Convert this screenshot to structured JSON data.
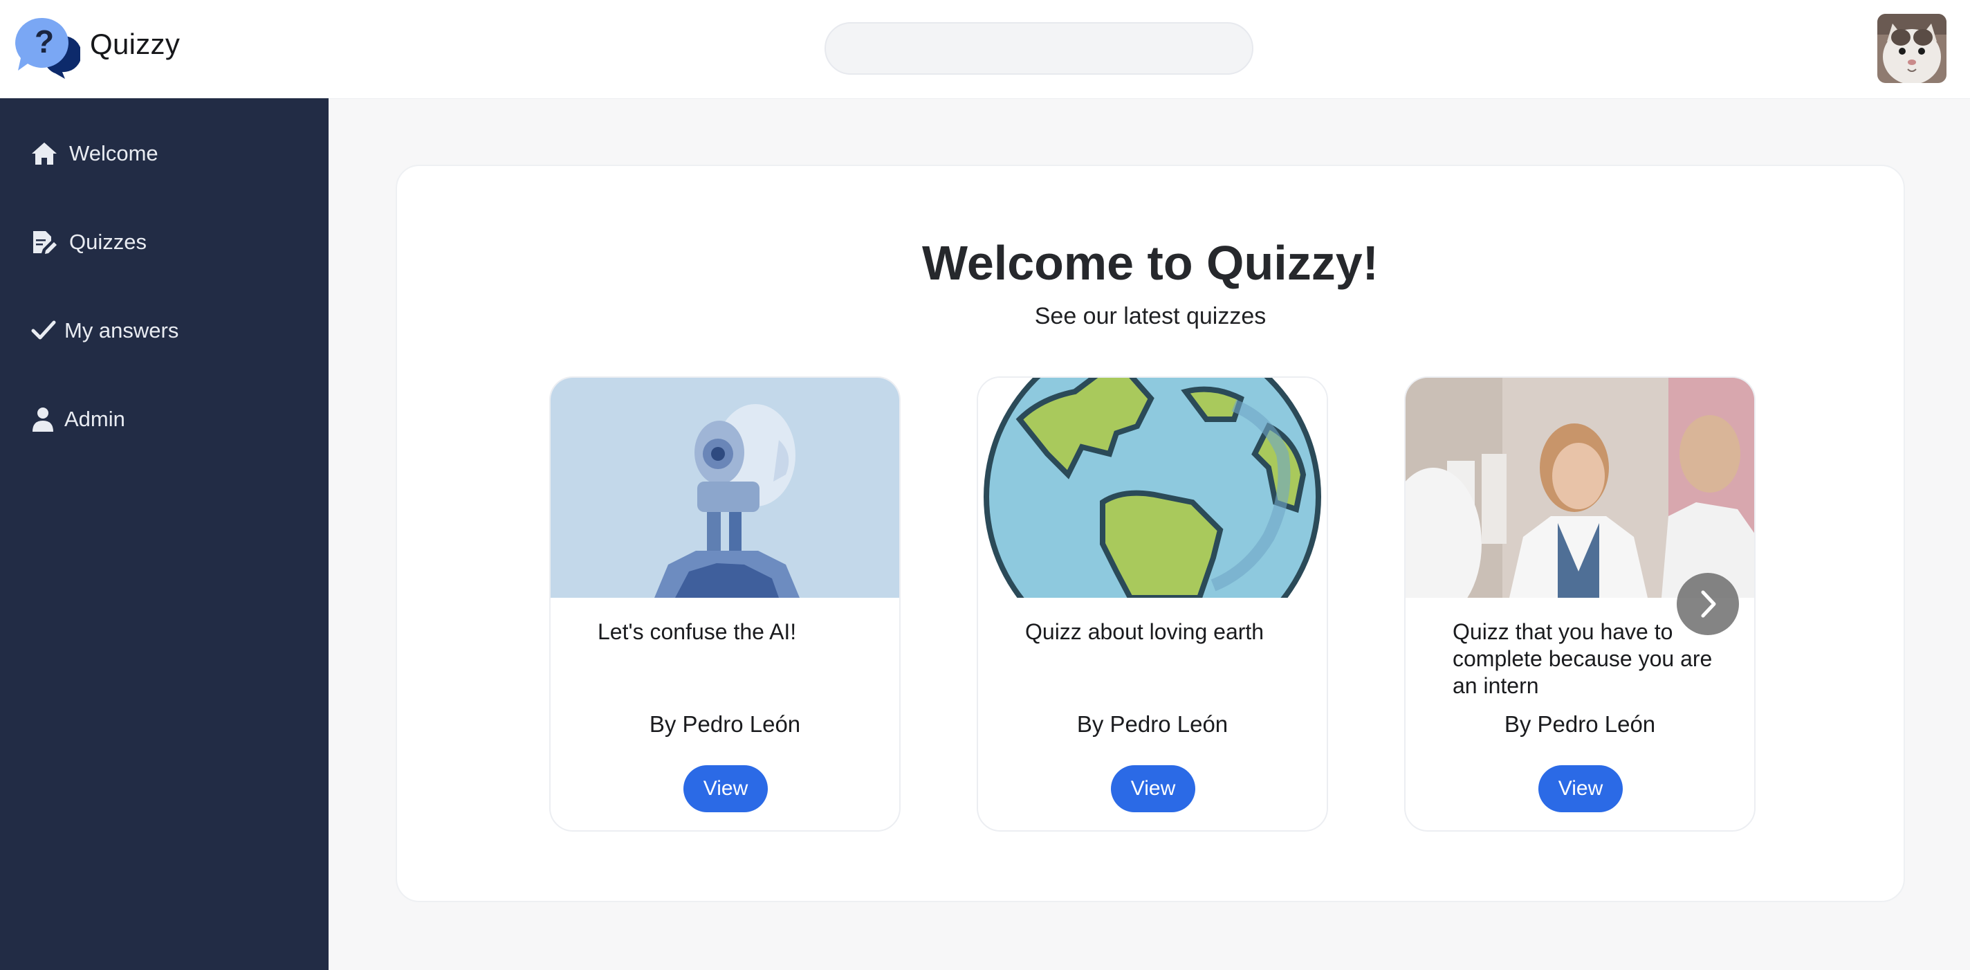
{
  "app": {
    "brand": "Quizzy"
  },
  "header": {
    "search_placeholder": "",
    "search_value": ""
  },
  "sidebar": {
    "items": [
      {
        "label": "Welcome",
        "icon": "home-icon"
      },
      {
        "label": "Quizzes",
        "icon": "quiz-edit-icon"
      },
      {
        "label": "My answers",
        "icon": "check-icon"
      },
      {
        "label": "Admin",
        "icon": "user-icon"
      }
    ]
  },
  "main": {
    "title": "Welcome to Quizzy!",
    "subtitle": "See our latest quizzes",
    "quizzes": [
      {
        "title": "Let's confuse the AI!",
        "author": "By Pedro León",
        "button": "View",
        "image": "robot-image"
      },
      {
        "title": "Quizz about loving earth",
        "author": "By Pedro León",
        "button": "View",
        "image": "earth-image"
      },
      {
        "title": "Quizz that you have to complete because you are an intern",
        "author": "By Pedro León",
        "button": "View",
        "image": "doctors-image"
      }
    ],
    "next_icon": "chevron-right-icon"
  },
  "colors": {
    "sidebar_bg": "#222c45",
    "accent": "#2b6ae6",
    "page_bg": "#f7f7f8",
    "card_bg": "#ffffff"
  }
}
